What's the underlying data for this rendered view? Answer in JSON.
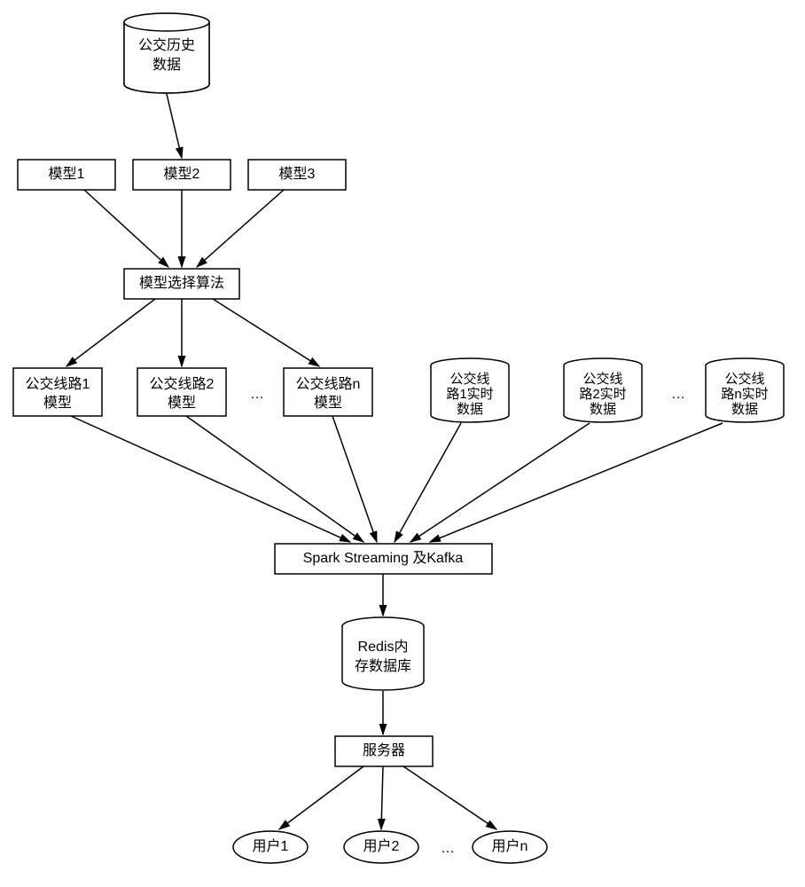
{
  "nodes": {
    "history": "公交历史\n数据",
    "model1": "模型1",
    "model2": "模型2",
    "model3": "模型3",
    "select": "模型选择算法",
    "line1": "公交线路1\n模型",
    "line2": "公交线路2\n模型",
    "linen": "公交线路n\n模型",
    "rt1": "公交线\n路1实时\n数据",
    "rt2": "公交线\n路2实时\n数据",
    "rtn": "公交线\n路n实时\n数据",
    "spark": "Spark Streaming 及Kafka",
    "redis": "Redis内\n存数据库",
    "server": "服务器",
    "user1": "用户1",
    "user2": "用户2",
    "usern": "用户n",
    "dots1": "…",
    "dots2": "…",
    "dots3": "…"
  }
}
